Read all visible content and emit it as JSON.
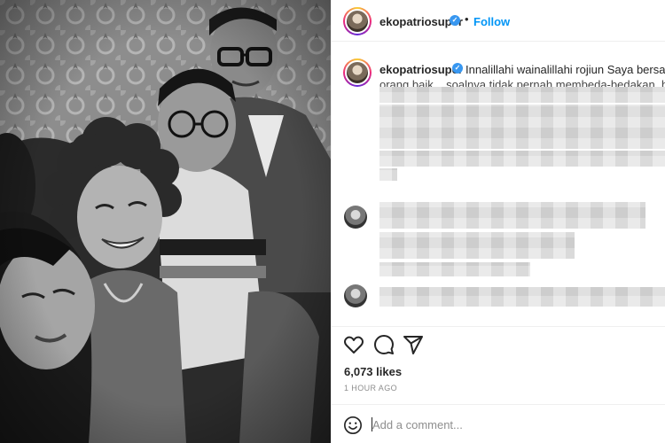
{
  "post": {
    "username": "ekopatriosuper",
    "follow_label": "Follow",
    "separator": "•",
    "verified_mark": "✓",
    "caption_text": "Innalillahi wainalillahi rojiun Saya bersaksi bun",
    "caption_cutoff": "orang baik... soalnya tidak pernah membeda-bedakan, baik dan",
    "likes": "6,073 likes",
    "time": "1 HOUR AGO"
  },
  "comment_box": {
    "placeholder": "Add a comment..."
  },
  "icons": {
    "like": "heart-icon",
    "comment": "comment-bubble-icon",
    "share": "send-icon",
    "emoji": "emoji-smiley-icon",
    "verified": "verified-badge-icon"
  },
  "colors": {
    "follow_blue": "#0095f6",
    "verified_blue": "#3897f0",
    "muted_text": "#8e8e8e",
    "divider": "#efefef"
  }
}
